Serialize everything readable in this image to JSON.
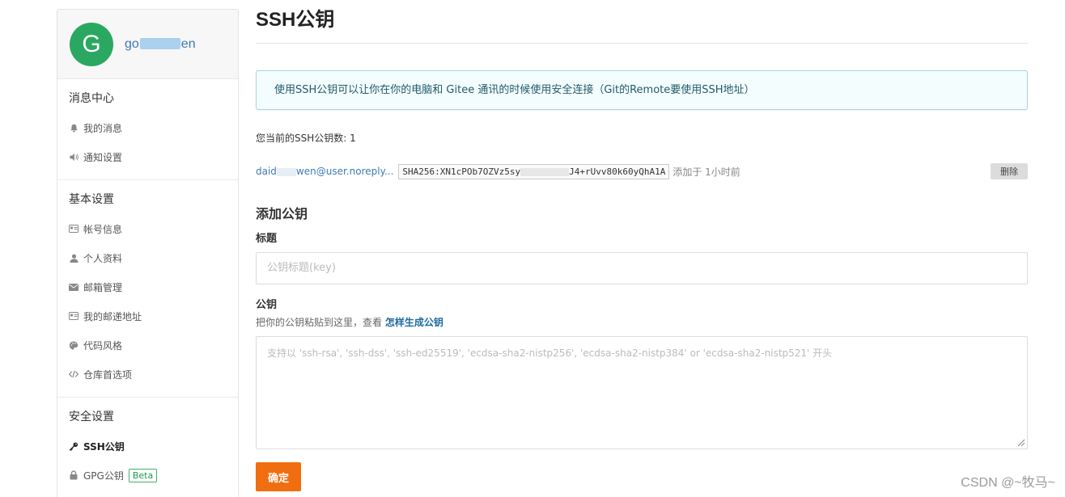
{
  "profile": {
    "avatar_letter": "G",
    "username_prefix": "go",
    "username_suffix": "en",
    "avatar_color": "#2aa862"
  },
  "sidebar": {
    "sections": [
      {
        "title": "消息中心",
        "items": [
          {
            "label": "我的消息",
            "icon": "bell-icon"
          },
          {
            "label": "通知设置",
            "icon": "speaker-icon"
          }
        ]
      },
      {
        "title": "基本设置",
        "items": [
          {
            "label": "帐号信息",
            "icon": "id-card-icon"
          },
          {
            "label": "个人资料",
            "icon": "user-icon"
          },
          {
            "label": "邮箱管理",
            "icon": "envelope-icon"
          },
          {
            "label": "我的邮递地址",
            "icon": "address-card-icon"
          },
          {
            "label": "代码风格",
            "icon": "palette-icon"
          },
          {
            "label": "仓库首选项",
            "icon": "code-icon"
          }
        ]
      },
      {
        "title": "安全设置",
        "items": [
          {
            "label": "SSH公钥",
            "icon": "key-icon",
            "active": true
          },
          {
            "label": "GPG公钥",
            "icon": "lock-icon",
            "badge": "Beta"
          }
        ]
      }
    ]
  },
  "main": {
    "title": "SSH公钥",
    "info": "使用SSH公钥可以让你在你的电脑和 Gitee 通讯的时候使用安全连接（Git的Remote要使用SSH地址）",
    "key_count_text": "您当前的SSH公钥数: 1",
    "key": {
      "email_prefix": "daid",
      "email_suffix": "wen@user.noreply...",
      "fingerprint_prefix": "SHA256:XN1cPOb7OZVz5sy",
      "fingerprint_suffix": "J4+rUvv80k60yQhA1A",
      "added": "添加于 1小时前",
      "delete_label": "删除"
    },
    "add_title": "添加公钥",
    "title_label": "标题",
    "title_placeholder": "公钥标题(key)",
    "key_label": "公钥",
    "hint_text": "把你的公钥粘贴到这里，查看 ",
    "hint_link": "怎样生成公钥",
    "key_placeholder": "支持以 'ssh-rsa', 'ssh-dss', 'ssh-ed25519', 'ecdsa-sha2-nistp256', 'ecdsa-sha2-nistp384' or 'ecdsa-sha2-nistp521' 开头",
    "confirm_label": "确定",
    "accent_color": "#f06e0f"
  },
  "watermark": "CSDN @~牧马~"
}
